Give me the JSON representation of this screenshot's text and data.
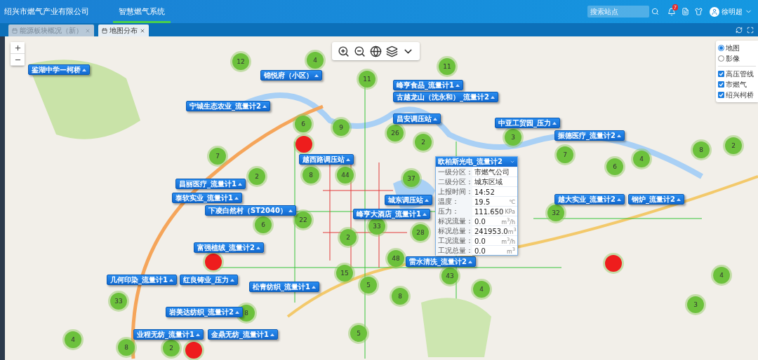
{
  "header": {
    "company": "绍兴市燃气产业有限公司",
    "nav": [
      {
        "label": "智慧燃气系统",
        "selected": true
      }
    ],
    "search": {
      "placeholder": "搜索站点"
    },
    "notifications": "7",
    "user": "徐明超"
  },
  "tabs": [
    {
      "label": "能源板块概况（新）",
      "selected": false
    },
    {
      "label": "地图分布",
      "selected": true
    }
  ],
  "map": {
    "layers": {
      "base": [
        {
          "label": "地图",
          "selected": true
        },
        {
          "label": "影像",
          "selected": false
        }
      ],
      "overlays": [
        {
          "label": "高压管线",
          "checked": true
        },
        {
          "label": "市燃气",
          "checked": true
        },
        {
          "label": "绍兴柯桥",
          "checked": true
        }
      ]
    },
    "clusters": [
      {
        "count": "12",
        "color": "#6cc13c"
      },
      {
        "count": "4",
        "color": "#6cc13c"
      },
      {
        "count": "11",
        "color": "#6cc13c"
      },
      {
        "count": "11",
        "color": "#6cc13c"
      },
      {
        "count": "6",
        "color": "#6cc13c"
      },
      {
        "count": "9",
        "color": "#6cc13c"
      },
      {
        "count": "26",
        "color": "#6cc13c"
      },
      {
        "count": "3",
        "color": "#6cc13c"
      },
      {
        "count": "2",
        "color": "#6cc13c"
      },
      {
        "color": "#ee1d1d"
      },
      {
        "count": "2",
        "color": "#6cc13c"
      },
      {
        "count": "8",
        "color": "#6cc13c"
      },
      {
        "count": "7",
        "color": "#6cc13c"
      },
      {
        "count": "7",
        "color": "#6cc13c"
      },
      {
        "count": "4",
        "color": "#6cc13c"
      },
      {
        "count": "6",
        "color": "#6cc13c"
      },
      {
        "count": "8",
        "color": "#6cc13c"
      },
      {
        "count": "44",
        "color": "#6cc13c"
      },
      {
        "count": "37",
        "color": "#6cc13c"
      },
      {
        "count": "2",
        "color": "#6cc13c"
      },
      {
        "count": "32",
        "color": "#6cc13c"
      },
      {
        "count": "22",
        "color": "#6cc13c"
      },
      {
        "count": "6",
        "color": "#6cc13c"
      },
      {
        "count": "33",
        "color": "#6cc13c"
      },
      {
        "count": "28",
        "color": "#6cc13c"
      },
      {
        "count": "2",
        "color": "#6cc13c"
      },
      {
        "color": "#ee1d1d"
      },
      {
        "count": "48",
        "color": "#6cc13c"
      },
      {
        "color": "#ee1d1d"
      },
      {
        "count": "43",
        "color": "#6cc13c"
      },
      {
        "count": "15",
        "color": "#6cc13c"
      },
      {
        "count": "4",
        "color": "#6cc13c"
      },
      {
        "count": "5",
        "color": "#6cc13c"
      },
      {
        "count": "4",
        "color": "#6cc13c"
      },
      {
        "count": "8",
        "color": "#6cc13c"
      },
      {
        "count": "33",
        "color": "#6cc13c"
      },
      {
        "count": "3",
        "color": "#6cc13c"
      },
      {
        "count": "8",
        "color": "#6cc13c"
      },
      {
        "count": "5",
        "color": "#6cc13c"
      },
      {
        "count": "4",
        "color": "#6cc13c"
      },
      {
        "count": "8",
        "color": "#6cc13c"
      },
      {
        "count": "2",
        "color": "#6cc13c"
      },
      {
        "color": "#ee1d1d"
      }
    ],
    "stations": [
      {
        "label": "鉴湖中学—柯桥"
      },
      {
        "label": "锦悦府（小区）"
      },
      {
        "label": "宁城生态农业_流量计2"
      },
      {
        "label": "峰亨食品_流量计1"
      },
      {
        "label": "古越龙山（沈永和）_流量计2"
      },
      {
        "label": "昌安调压站"
      },
      {
        "label": "中亚工贸园_压力"
      },
      {
        "label": "振德医疗_流量计2"
      },
      {
        "label": "越西路调压站"
      },
      {
        "label": "昌丽医疗_流量计1"
      },
      {
        "label": "泰软实业_流量计1"
      },
      {
        "label": "下凌白然村（ST2040）"
      },
      {
        "label": "城东调压站"
      },
      {
        "label": "峰亨大酒店_流量计1"
      },
      {
        "label": "越大实业_流量计2"
      },
      {
        "label": "钢炉_流量计2"
      },
      {
        "label": "富强植绒_流量计2"
      },
      {
        "label": "雷水清洗_流量计2"
      },
      {
        "label": "几何印染_流量计1"
      },
      {
        "label": "红良铸业_压力"
      },
      {
        "label": "松青纺织_流量计1"
      },
      {
        "label": "岩美达纺织_流量计2"
      },
      {
        "label": "业程无纺_流量计1"
      },
      {
        "label": "金鼎无纺_流量计1"
      }
    ],
    "popup": {
      "title": "欧柏斯光电_流量计2",
      "rows": [
        {
          "label": "一级分区：",
          "value": "市燃气公司"
        },
        {
          "label": "二级分区：",
          "value": "城东区域"
        },
        {
          "label": "上报时间：",
          "value": "14:52"
        },
        {
          "label": "温度：",
          "value": "19.5",
          "unit": "℃"
        },
        {
          "label": "压力：",
          "value": "111.650",
          "unit": "KPa"
        },
        {
          "label": "标况流量：",
          "value": "0.0",
          "unit": "m$^{3}$/h"
        },
        {
          "label": "标况总量：",
          "value": "241953.0",
          "unit": "m$^{3}$"
        },
        {
          "label": "工况流量：",
          "value": "0.0",
          "unit": "m$^{3}$/h"
        },
        {
          "label": "工况总量：",
          "value": "0.0",
          "unit": "m$^{3}$"
        }
      ]
    }
  }
}
